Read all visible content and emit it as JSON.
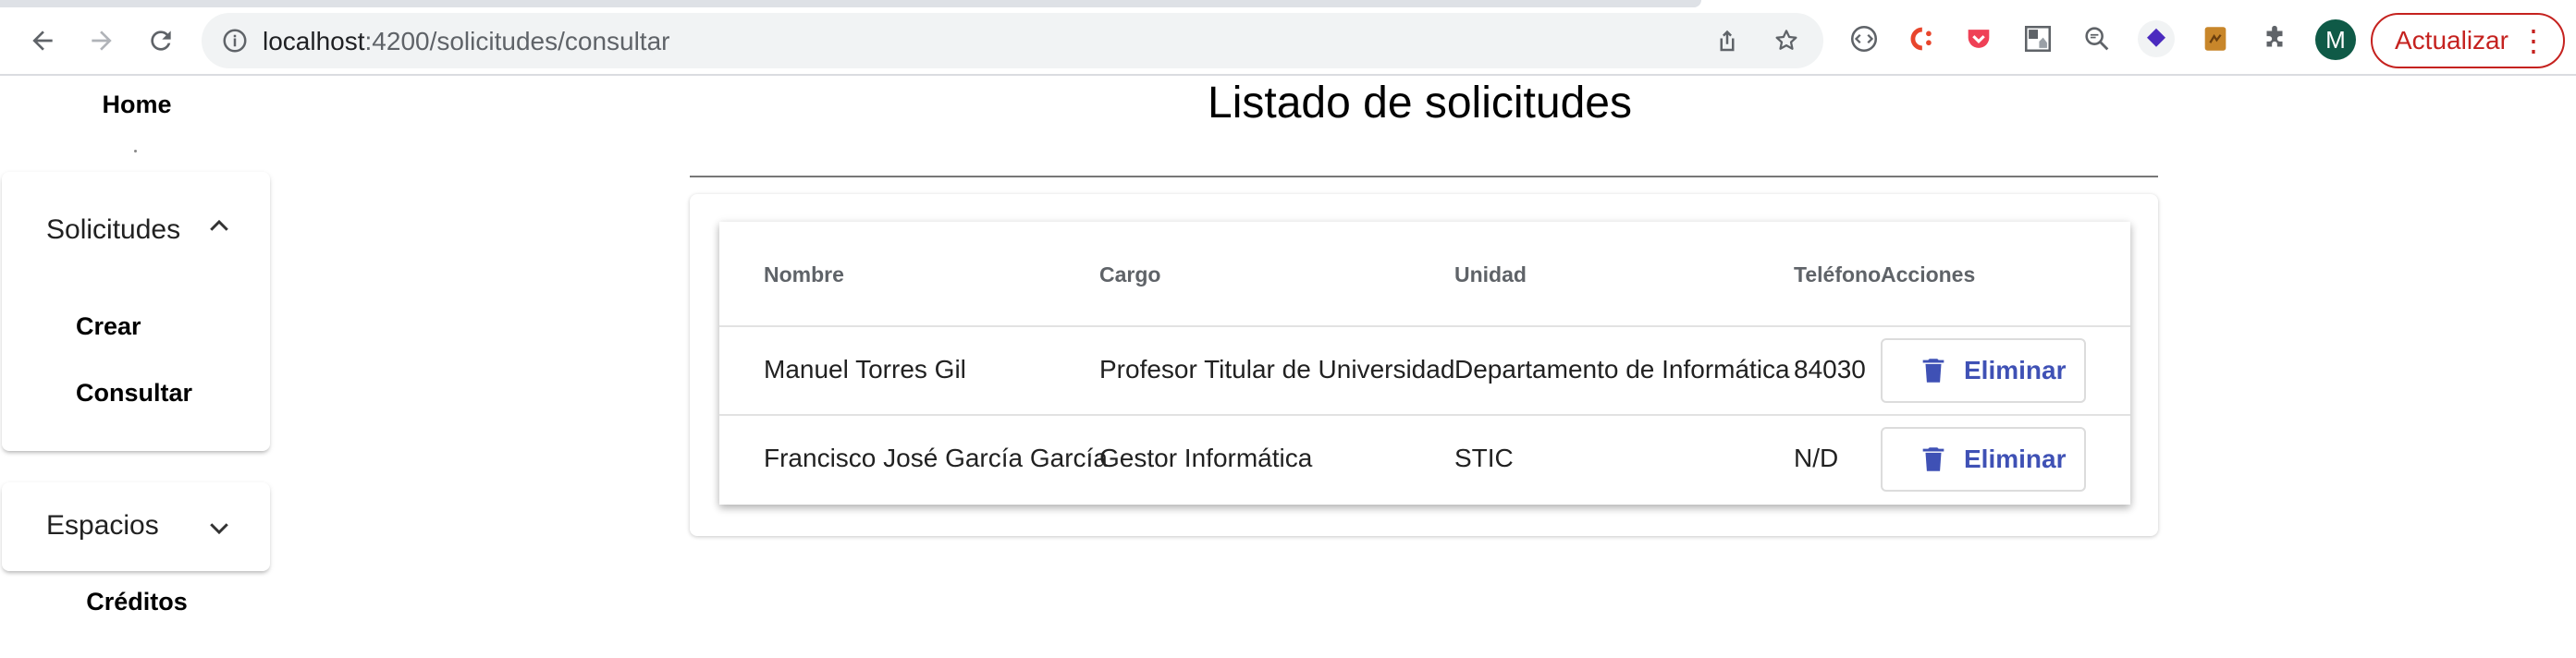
{
  "browser": {
    "url_host": "localhost",
    "url_path": ":4200/solicitudes/consultar",
    "avatar_letter": "M",
    "update_label": "Actualizar",
    "update_menu": "⋮"
  },
  "sidebar": {
    "home": "Home",
    "solicitudes": {
      "label": "Solicitudes",
      "expanded": true,
      "items": [
        "Crear",
        "Consultar"
      ]
    },
    "espacios": {
      "label": "Espacios",
      "expanded": false
    },
    "creditos": "Créditos"
  },
  "main": {
    "title": "Listado de solicitudes",
    "table": {
      "headers": [
        "Nombre",
        "Cargo",
        "Unidad",
        "Teléfono",
        "Acciones"
      ],
      "rows": [
        {
          "nombre": "Manuel Torres Gil",
          "cargo": "Profesor Titular de Universidad",
          "unidad": "Departamento de Informática",
          "telefono": "84030",
          "accion": "Eliminar"
        },
        {
          "nombre": "Francisco José García García",
          "cargo": "Gestor Informática",
          "unidad": "STIC",
          "telefono": "N/D",
          "accion": "Eliminar"
        }
      ]
    }
  },
  "colors": {
    "primary": "#3f51b5",
    "update_red": "#c5221f",
    "avatar_green": "#0f5a47"
  }
}
